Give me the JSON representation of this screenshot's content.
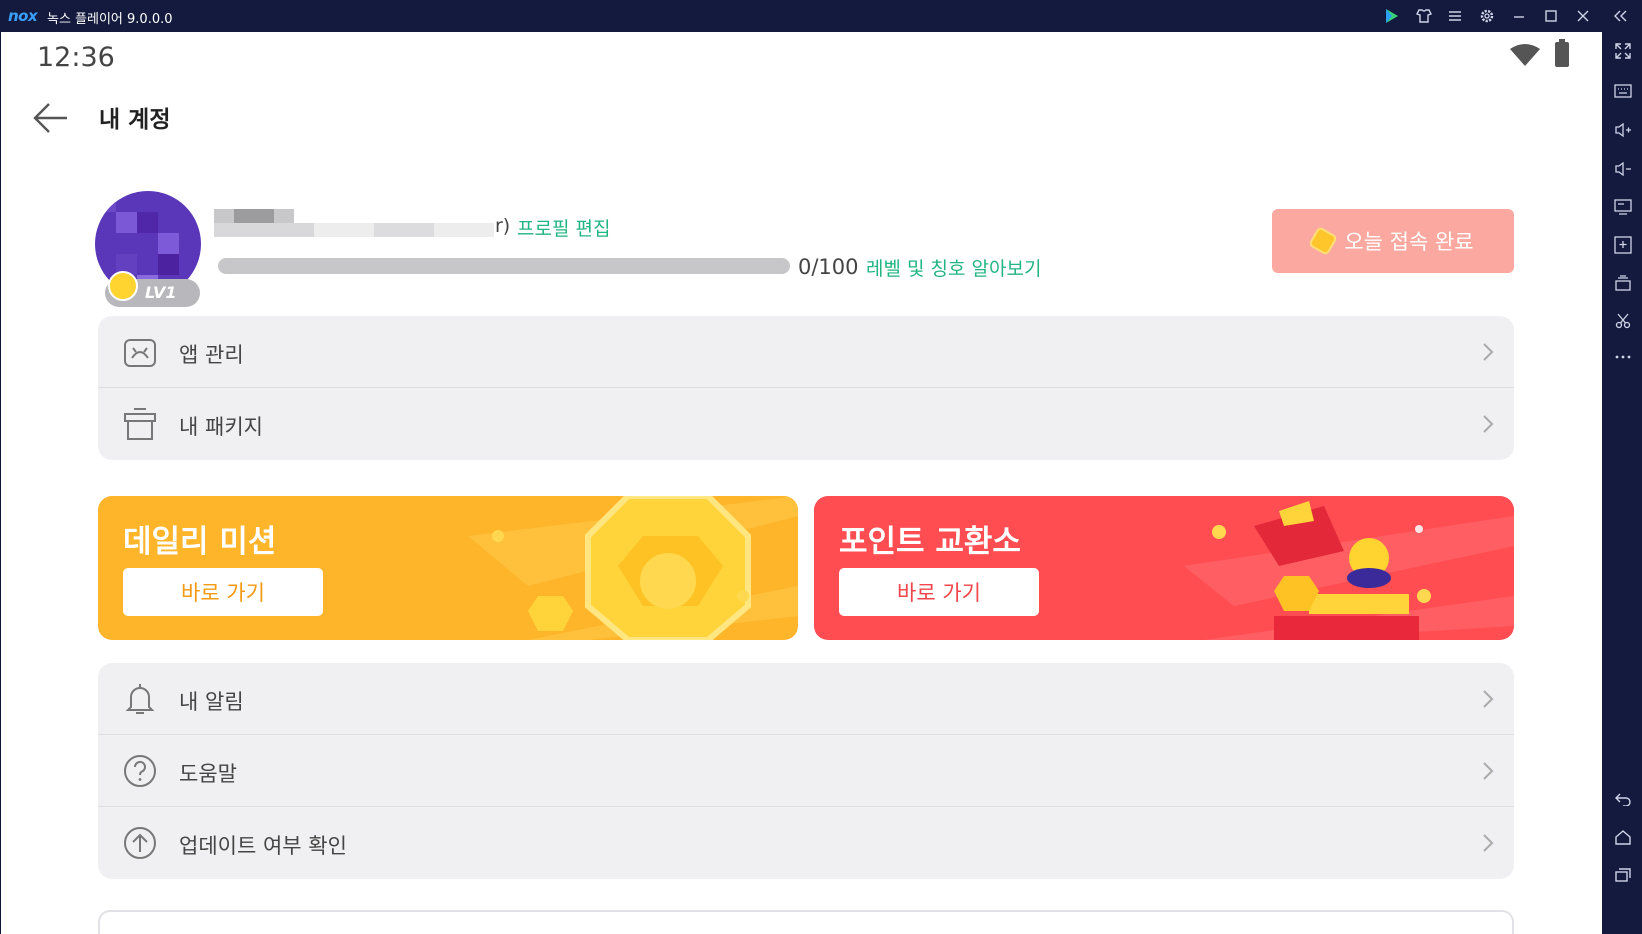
{
  "emulator": {
    "logo": "nox",
    "title": "녹스 플레이어 9.0.0.0",
    "titlebar_icons": [
      "play-store-icon",
      "home-shirt-icon",
      "menu-icon",
      "settings-icon",
      "minimize-icon",
      "maximize-icon",
      "close-icon",
      "collapse-icon"
    ],
    "toolbar_icons": [
      "fullscreen-icon",
      "keyboard-icon",
      "volume-up-icon",
      "volume-down-icon",
      "screen-icon",
      "apk-install-icon",
      "multi-instance-icon",
      "scissors-icon",
      "more-icon",
      "back-icon",
      "home-icon",
      "recent-apps-icon"
    ]
  },
  "status_bar": {
    "time": "12:36"
  },
  "header": {
    "title": "내 계정"
  },
  "profile": {
    "username_tail": "r)",
    "edit_link": "프로필 편집",
    "level_badge": "LV1",
    "xp_progress": 0,
    "xp_text": "0/100",
    "level_link": "레벨 및 칭호 알아보기",
    "checkin_button": "오늘 접속 완료"
  },
  "menu_top": [
    {
      "label": "앱 관리",
      "icon": "android-icon"
    },
    {
      "label": "내 패키지",
      "icon": "gift-box-icon"
    }
  ],
  "promos": {
    "daily": {
      "title": "데일리 미션",
      "button": "바로 가기"
    },
    "points": {
      "title": "포인트 교환소",
      "button": "바로 가기"
    }
  },
  "menu_bottom": [
    {
      "label": "내 알림",
      "icon": "bell-icon"
    },
    {
      "label": "도움말",
      "icon": "help-icon"
    },
    {
      "label": "업데이트 여부 확인",
      "icon": "update-icon"
    }
  ],
  "colors": {
    "accent_green": "#20b581",
    "checkin_bg": "#fba9a0",
    "daily_bg": "#ffb52a",
    "points_bg": "#ff4d52"
  }
}
